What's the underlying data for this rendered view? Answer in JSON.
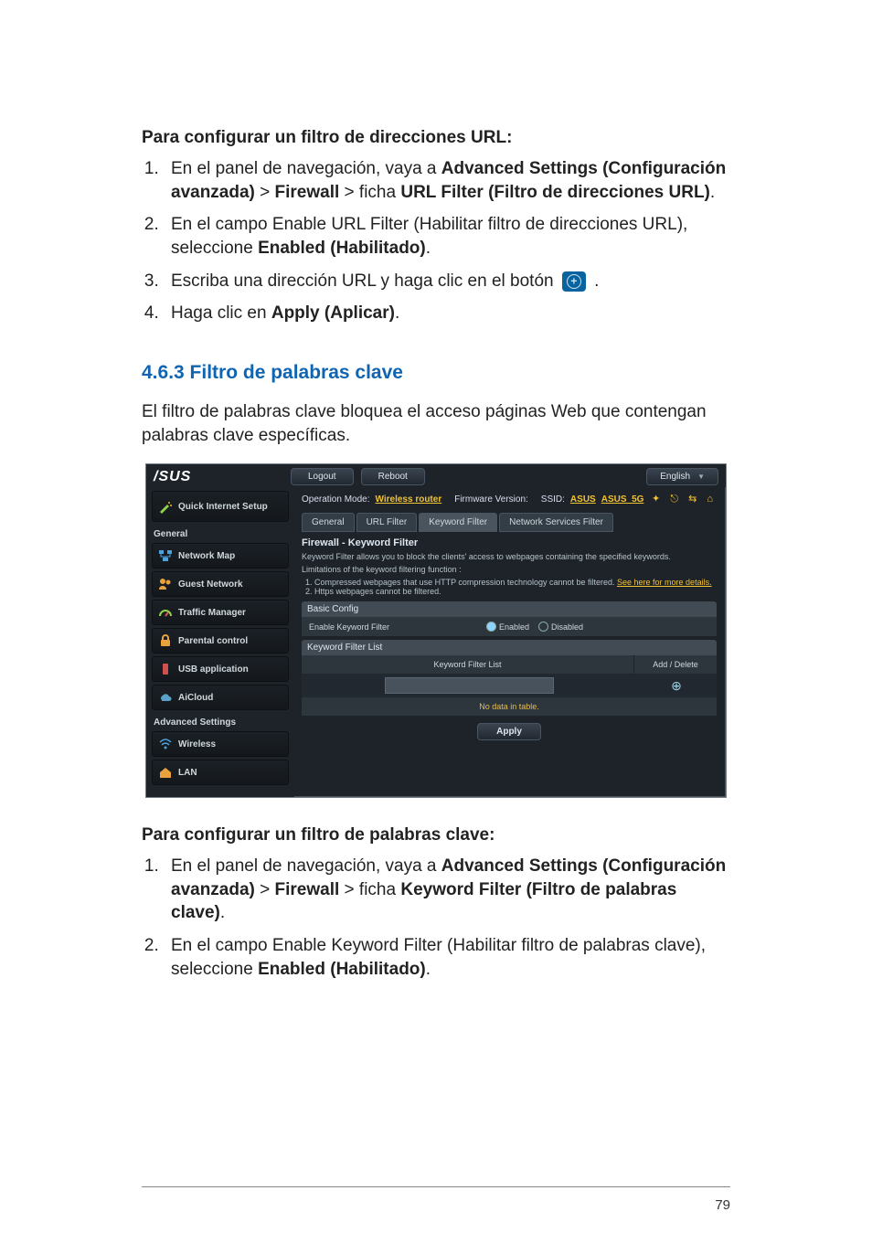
{
  "doc": {
    "heading1": "Para configurar un filtro de direcciones URL:",
    "list1": {
      "i1a": "En el panel de navegación, vaya a ",
      "i1b": "Advanced Settings (Configuración avanzada)",
      "i1c": " > ",
      "i1d": "Firewall",
      "i1e": " > ficha ",
      "i1f": "URL Filter (Filtro de direcciones URL)",
      "i1g": ".",
      "i2a": "En el campo Enable URL Filter (Habilitar filtro de direcciones URL), seleccione ",
      "i2b": "Enabled (Habilitado)",
      "i2c": ".",
      "i3a": "Escriba una dirección URL y haga clic en el botón ",
      "i3b": " .",
      "i4a": "Haga clic en ",
      "i4b": "Apply (Aplicar)",
      "i4c": "."
    },
    "sectionHead": "4.6.3  Filtro de palabras clave",
    "sectionBody": "El filtro de palabras clave bloquea el acceso páginas Web que contengan palabras clave específicas.",
    "heading2": "Para configurar un filtro de palabras clave:",
    "list2": {
      "i1a": "En el panel de navegación, vaya a ",
      "i1b": "Advanced Settings (Configuración avanzada)",
      "i1c": " > ",
      "i1d": "Firewall",
      "i1e": " > ficha ",
      "i1f": "Keyword Filter (Filtro de palabras clave)",
      "i1g": ".",
      "i2a": "En el campo Enable Keyword Filter (Habilitar filtro de palabras clave), seleccione ",
      "i2b": "Enabled (Habilitado)",
      "i2c": "."
    },
    "pageNumber": "79"
  },
  "ui": {
    "logo": "/SUS",
    "logout": "Logout",
    "reboot": "Reboot",
    "lang": "English",
    "opMode": "Operation Mode:",
    "opModeVal": "Wireless router",
    "fwVer": "Firmware Version:",
    "ssidLabel": "SSID:",
    "ssid1": "ASUS",
    "ssid2": "ASUS_5G",
    "tabs": {
      "general": "General",
      "url": "URL Filter",
      "keyword": "Keyword Filter",
      "netsvc": "Network Services Filter"
    },
    "side": {
      "quick": "Quick Internet Setup",
      "groupGeneral": "General",
      "netmap": "Network Map",
      "guest": "Guest Network",
      "traffic": "Traffic Manager",
      "parental": "Parental control",
      "usb": "USB application",
      "aicloud": "AiCloud",
      "groupAdv": "Advanced Settings",
      "wireless": "Wireless",
      "lan": "LAN"
    },
    "panel": {
      "title": "Firewall - Keyword Filter",
      "desc": "Keyword Filter allows you to block the clients' access to webpages containing the specified keywords.",
      "limits": "Limitations of the keyword filtering function :",
      "note1a": "Compressed webpages that use HTTP compression technology cannot be filtered. ",
      "note1b": "See here for more details.",
      "note2": "Https webpages cannot be filtered.",
      "basic": "Basic Config",
      "enableLabel": "Enable Keyword Filter",
      "enabled": "Enabled",
      "disabled": "Disabled",
      "listHead": "Keyword Filter List",
      "colList": "Keyword Filter List",
      "colAction": "Add / Delete",
      "empty": "No data in table.",
      "apply": "Apply"
    }
  }
}
